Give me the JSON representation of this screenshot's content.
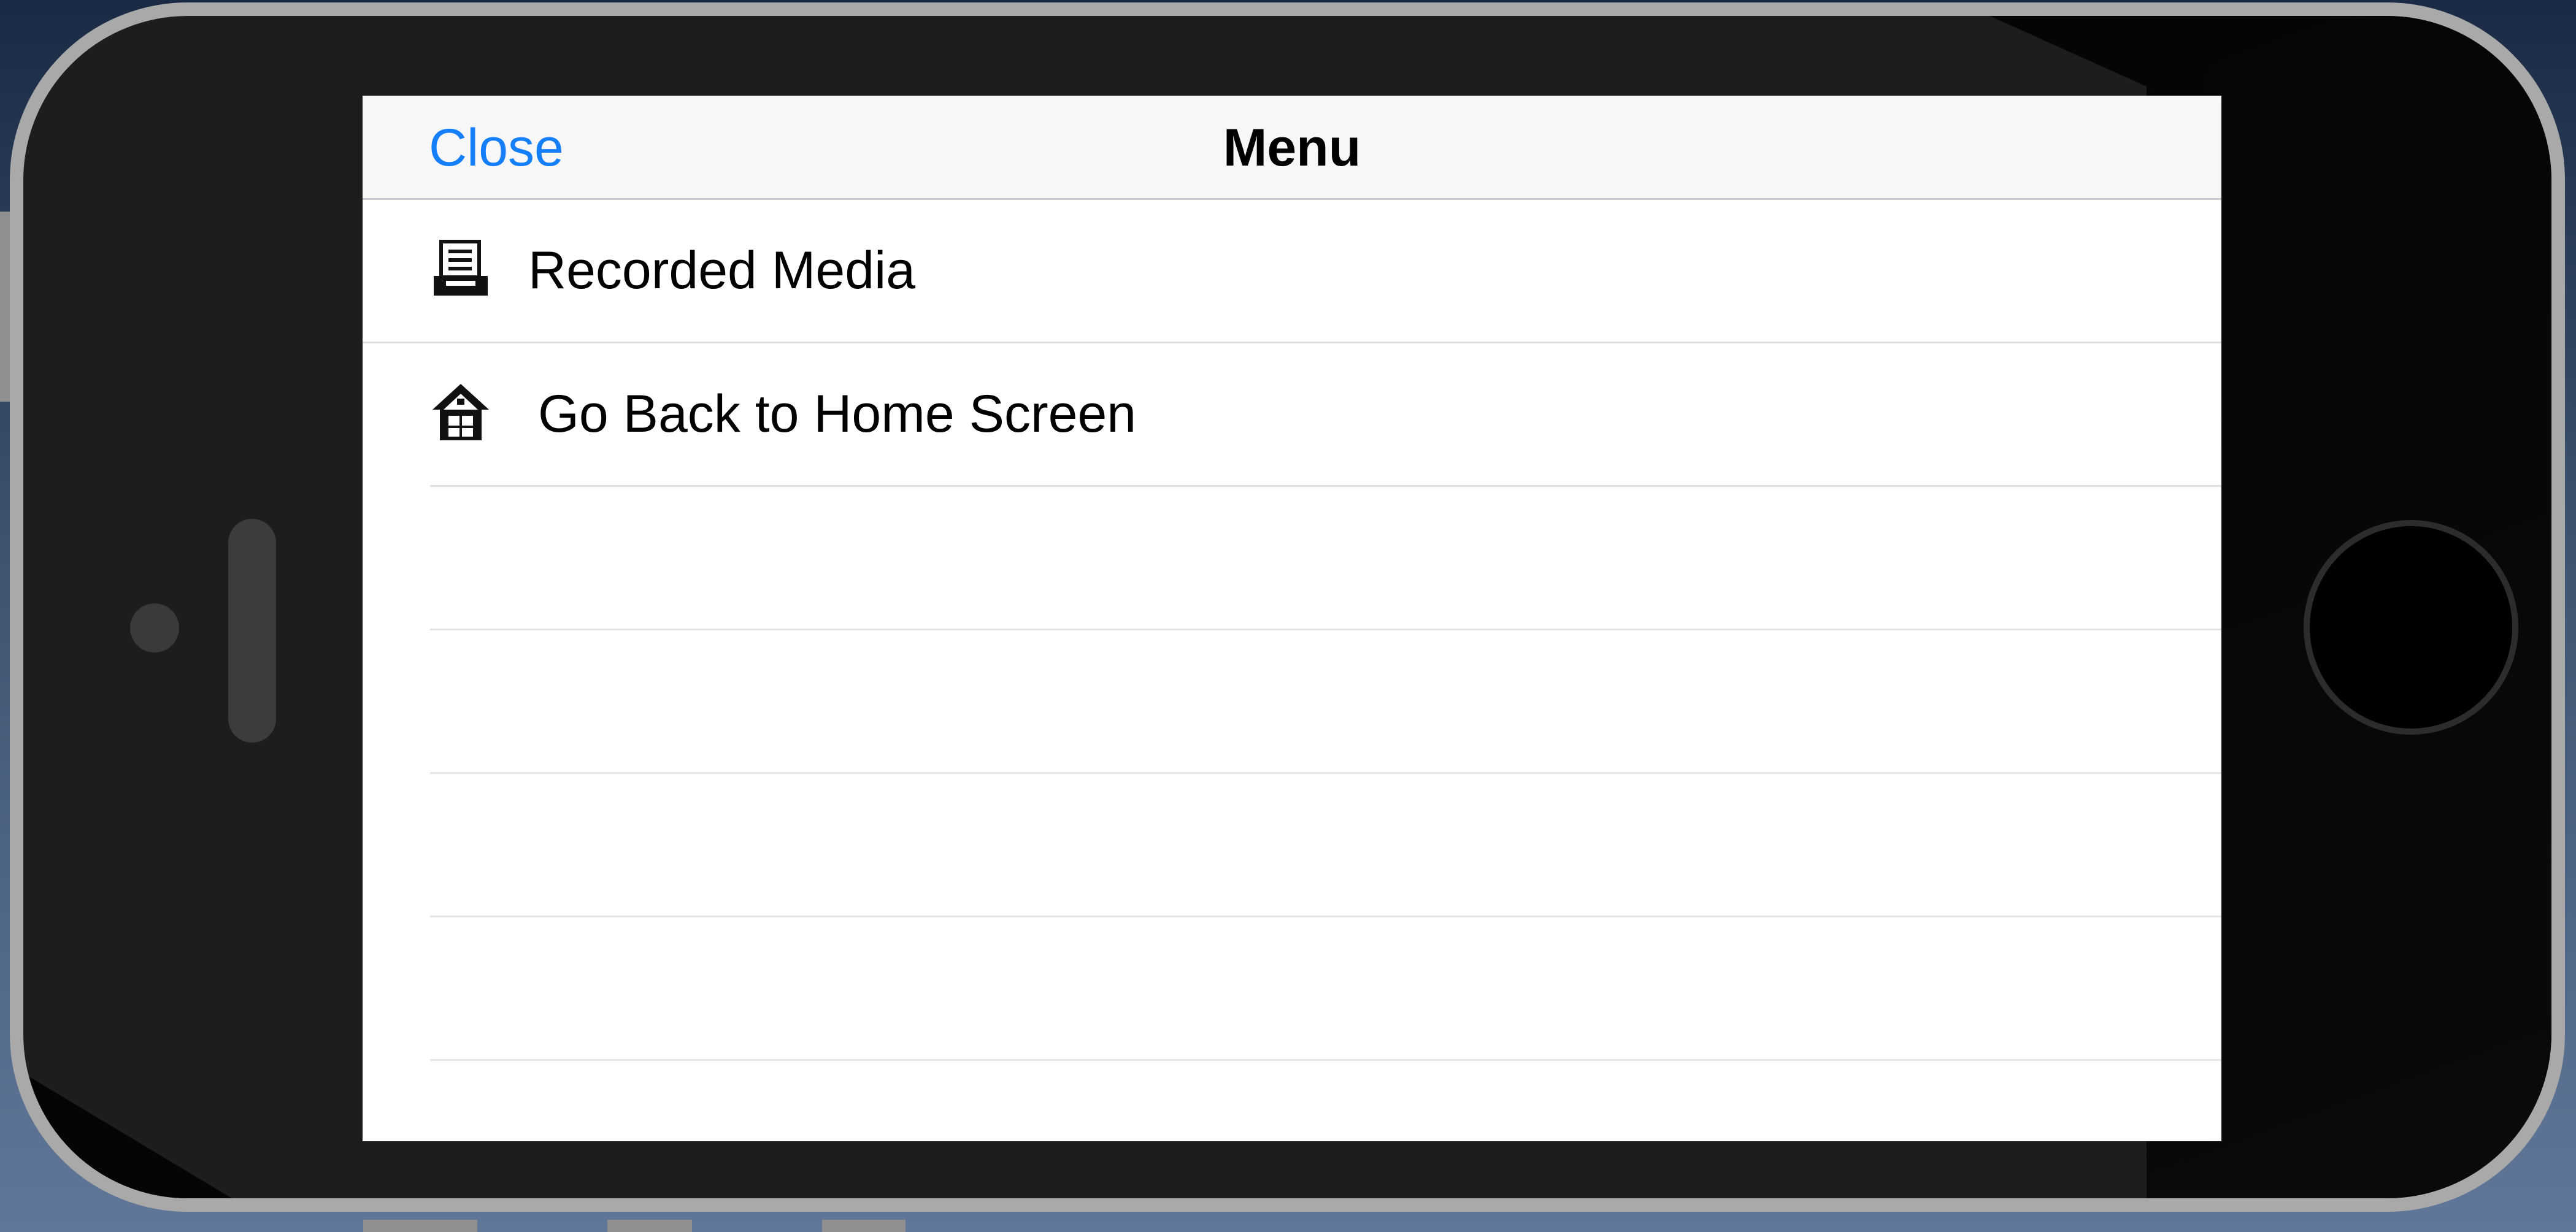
{
  "nav": {
    "close_label": "Close",
    "title": "Menu"
  },
  "menu": {
    "items": [
      {
        "label": "Recorded Media",
        "icon": "media-archive-icon"
      },
      {
        "label": "Go Back to Home Screen",
        "icon": "home-icon"
      }
    ]
  },
  "colors": {
    "accent": "#147efb",
    "nav_background": "#f7f7f7",
    "separator": "#e0e0e3",
    "device_frame": "#a9a9a9",
    "device_body": "#1d1d1d"
  }
}
